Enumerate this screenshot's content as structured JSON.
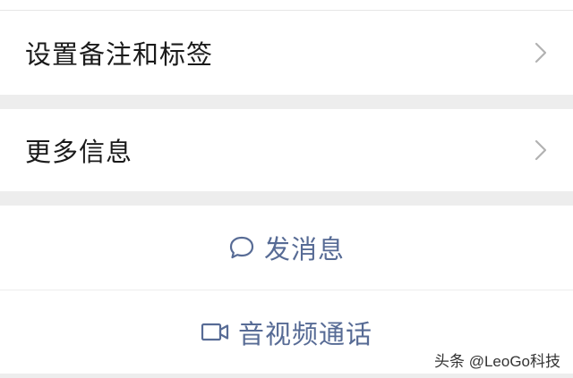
{
  "menu": {
    "items": [
      {
        "label": "设置备注和标签"
      },
      {
        "label": "更多信息"
      }
    ]
  },
  "actions": {
    "message_label": "发消息",
    "video_call_label": "音视频通话"
  },
  "icons": {
    "chevron": "chevron-right-icon",
    "message": "chat-bubble-icon",
    "video": "video-camera-icon"
  },
  "colors": {
    "background": "#ededed",
    "surface": "#ffffff",
    "action_text": "#576b95",
    "primary_text": "#1a1a1a",
    "chevron": "#b2b2b2"
  },
  "watermark": "头条 @LeoGo科技"
}
